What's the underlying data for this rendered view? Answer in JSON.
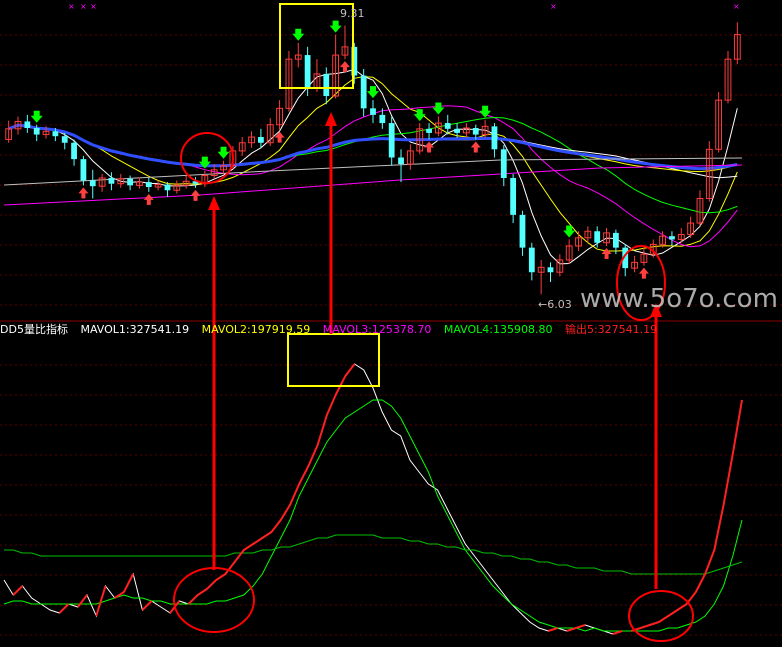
{
  "colors": {
    "background": "#000000",
    "separator": "#8b0000",
    "grid": "#5a0000",
    "candle_up": "#ff3c3c",
    "candle_down": "#54ffff",
    "mavol1": "#ffffff",
    "mavol2": "#ffff00",
    "mavol3": "#ff00ff",
    "mavol4": "#00ff00",
    "output5": "#ff2020",
    "annotation": "#ff0000",
    "highlight_box": "#ffff00"
  },
  "price_panel": {
    "high_label": "9.31",
    "low_label": "6.03",
    "low_prefix": "←",
    "watermark": "www.5o7o.com"
  },
  "legend": {
    "name": "DD5量比指标",
    "items": [
      {
        "key": "mavol1",
        "text": "MAVOL1:327541.19",
        "color": "#ffffff"
      },
      {
        "key": "mavol2",
        "text": "MAVOL2:197919.59",
        "color": "#ffff00"
      },
      {
        "key": "mavol3",
        "text": "MAVOL3:125378.70",
        "color": "#ff00ff"
      },
      {
        "key": "mavol4",
        "text": "MAVOL4:135908.80",
        "color": "#00ff00"
      },
      {
        "key": "output5",
        "text": "输出5:327541.19",
        "color": "#ff2020"
      }
    ]
  },
  "chart_data": [
    {
      "type": "candlestick",
      "title": "",
      "ylim": [
        5.9,
        9.5
      ],
      "annotations": [
        "9.31",
        "←6.03"
      ],
      "candles": [
        [
          7.92,
          8.05,
          8.15,
          7.88
        ],
        [
          8.05,
          8.14,
          8.2,
          7.98
        ],
        [
          8.14,
          8.06,
          8.22,
          8.0
        ],
        [
          8.06,
          7.98,
          8.1,
          7.9
        ],
        [
          7.98,
          8.02,
          8.08,
          7.93
        ],
        [
          8.02,
          7.96,
          8.06,
          7.9
        ],
        [
          7.96,
          7.88,
          8.0,
          7.8
        ],
        [
          7.88,
          7.68,
          7.92,
          7.6
        ],
        [
          7.68,
          7.42,
          7.72,
          7.36
        ],
        [
          7.42,
          7.35,
          7.55,
          7.2
        ],
        [
          7.35,
          7.45,
          7.5,
          7.28
        ],
        [
          7.45,
          7.38,
          7.52,
          7.3
        ],
        [
          7.38,
          7.44,
          7.5,
          7.33
        ],
        [
          7.44,
          7.36,
          7.48,
          7.3
        ],
        [
          7.36,
          7.4,
          7.46,
          7.32
        ],
        [
          7.4,
          7.34,
          7.45,
          7.28
        ],
        [
          7.34,
          7.37,
          7.42,
          7.3
        ],
        [
          7.37,
          7.3,
          7.4,
          7.22
        ],
        [
          7.3,
          7.36,
          7.42,
          7.26
        ],
        [
          7.36,
          7.41,
          7.48,
          7.32
        ],
        [
          7.41,
          7.38,
          7.46,
          7.33
        ],
        [
          7.38,
          7.48,
          7.54,
          7.34
        ],
        [
          7.48,
          7.55,
          7.62,
          7.44
        ],
        [
          7.55,
          7.6,
          7.66,
          7.5
        ],
        [
          7.6,
          7.78,
          7.84,
          7.56
        ],
        [
          7.78,
          7.88,
          7.95,
          7.72
        ],
        [
          7.88,
          7.95,
          8.02,
          7.82
        ],
        [
          7.95,
          7.88,
          8.05,
          7.82
        ],
        [
          7.88,
          8.1,
          8.18,
          7.84
        ],
        [
          8.1,
          8.3,
          8.4,
          8.04
        ],
        [
          8.3,
          8.9,
          9.0,
          8.26
        ],
        [
          8.9,
          8.95,
          9.1,
          8.8
        ],
        [
          8.95,
          8.55,
          9.05,
          8.45
        ],
        [
          8.55,
          8.72,
          8.9,
          8.5
        ],
        [
          8.72,
          8.45,
          8.8,
          8.35
        ],
        [
          8.45,
          8.95,
          9.2,
          8.42
        ],
        [
          8.95,
          9.05,
          9.31,
          8.9
        ],
        [
          9.05,
          8.7,
          9.1,
          8.6
        ],
        [
          8.7,
          8.3,
          8.78,
          8.2
        ],
        [
          8.3,
          8.22,
          8.4,
          8.12
        ],
        [
          8.22,
          8.12,
          8.3,
          8.05
        ],
        [
          8.12,
          7.7,
          8.2,
          7.6
        ],
        [
          7.7,
          7.62,
          7.8,
          7.4
        ],
        [
          7.62,
          7.78,
          7.86,
          7.55
        ],
        [
          7.78,
          8.05,
          8.12,
          7.74
        ],
        [
          8.05,
          8.0,
          8.12,
          7.92
        ],
        [
          8.0,
          8.12,
          8.2,
          7.96
        ],
        [
          8.12,
          8.05,
          8.22,
          7.98
        ],
        [
          8.05,
          8.0,
          8.12,
          7.94
        ],
        [
          8.0,
          8.06,
          8.12,
          7.95
        ],
        [
          8.06,
          7.98,
          8.1,
          7.92
        ],
        [
          7.98,
          8.08,
          8.16,
          7.94
        ],
        [
          8.08,
          7.8,
          8.12,
          7.7
        ],
        [
          7.8,
          7.45,
          7.85,
          7.35
        ],
        [
          7.45,
          7.0,
          7.5,
          6.9
        ],
        [
          7.0,
          6.6,
          7.05,
          6.5
        ],
        [
          6.6,
          6.3,
          6.66,
          6.2
        ],
        [
          6.3,
          6.36,
          6.45,
          6.03
        ],
        [
          6.36,
          6.3,
          6.42,
          6.18
        ],
        [
          6.3,
          6.45,
          6.52,
          6.25
        ],
        [
          6.45,
          6.62,
          6.7,
          6.4
        ],
        [
          6.62,
          6.72,
          6.8,
          6.56
        ],
        [
          6.72,
          6.8,
          6.86,
          6.66
        ],
        [
          6.8,
          6.66,
          6.86,
          6.6
        ],
        [
          6.66,
          6.78,
          6.84,
          6.62
        ],
        [
          6.78,
          6.6,
          6.82,
          6.52
        ],
        [
          6.6,
          6.35,
          6.64,
          6.25
        ],
        [
          6.35,
          6.42,
          6.5,
          6.3
        ],
        [
          6.42,
          6.52,
          6.6,
          6.38
        ],
        [
          6.52,
          6.64,
          6.7,
          6.48
        ],
        [
          6.64,
          6.74,
          6.8,
          6.6
        ],
        [
          6.74,
          6.7,
          6.8,
          6.62
        ],
        [
          6.7,
          6.76,
          6.84,
          6.66
        ],
        [
          6.76,
          6.9,
          6.98,
          6.72
        ],
        [
          6.9,
          7.2,
          7.3,
          6.86
        ],
        [
          7.2,
          7.8,
          7.9,
          7.16
        ],
        [
          7.8,
          8.4,
          8.5,
          7.76
        ],
        [
          8.4,
          8.9,
          9.0,
          8.36
        ],
        [
          8.9,
          9.2,
          9.35,
          8.84
        ]
      ],
      "signals_buy": [
        3,
        21,
        23,
        31,
        35,
        39,
        44,
        46,
        51,
        60
      ],
      "signals_sell": [
        8,
        15,
        20,
        29,
        36,
        45,
        50,
        64,
        68
      ]
    },
    {
      "type": "line",
      "title": "DD5量比指标",
      "ylim": [
        0,
        100
      ],
      "series": [
        {
          "name": "MAVOL1",
          "values": [
            20,
            15,
            18,
            14,
            12,
            10,
            9,
            12,
            11,
            15,
            8,
            18,
            14,
            16,
            22,
            10,
            13,
            11,
            9,
            13,
            12,
            15,
            17,
            20,
            22,
            26,
            30,
            32,
            34,
            36,
            40,
            45,
            52,
            58,
            65,
            75,
            82,
            88,
            92,
            90,
            84,
            76,
            70,
            68,
            60,
            56,
            52,
            50,
            44,
            38,
            32,
            28,
            24,
            20,
            16,
            12,
            9,
            6,
            4,
            3,
            4,
            3,
            4,
            5,
            4,
            3,
            2,
            3,
            3,
            4,
            5,
            6,
            8,
            10,
            12,
            16,
            22,
            30,
            45,
            62,
            80
          ]
        },
        {
          "name": "MAVOL2",
          "values": [
            12,
            13,
            13,
            12,
            12,
            12,
            12,
            12,
            12,
            12,
            12,
            13,
            14,
            15,
            14,
            14,
            13,
            13,
            12,
            12,
            12,
            12,
            12,
            13,
            13,
            14,
            15,
            18,
            22,
            28,
            34,
            40,
            48,
            54,
            60,
            66,
            70,
            74,
            76,
            78,
            80,
            80,
            78,
            74,
            68,
            62,
            56,
            48,
            42,
            36,
            30,
            26,
            22,
            18,
            15,
            12,
            10,
            8,
            6,
            5,
            4,
            4,
            4,
            3,
            4,
            3,
            3,
            3,
            3,
            3,
            3,
            3,
            4,
            4,
            5,
            6,
            8,
            12,
            18,
            28,
            40
          ]
        },
        {
          "name": "MAVOL4",
          "values": [
            30,
            30,
            29,
            29,
            28,
            28,
            28,
            28,
            28,
            28,
            28,
            28,
            28,
            28,
            28,
            28,
            28,
            28,
            28,
            28,
            28,
            28,
            28,
            28,
            28,
            29,
            29,
            29,
            30,
            30,
            31,
            31,
            32,
            33,
            34,
            34,
            35,
            35,
            35,
            35,
            35,
            34,
            34,
            34,
            33,
            33,
            32,
            32,
            31,
            31,
            30,
            30,
            29,
            29,
            28,
            28,
            27,
            27,
            26,
            26,
            25,
            25,
            24,
            24,
            24,
            23,
            23,
            23,
            22,
            22,
            22,
            22,
            22,
            22,
            22,
            22,
            22,
            23,
            24,
            25,
            26
          ]
        }
      ]
    }
  ]
}
